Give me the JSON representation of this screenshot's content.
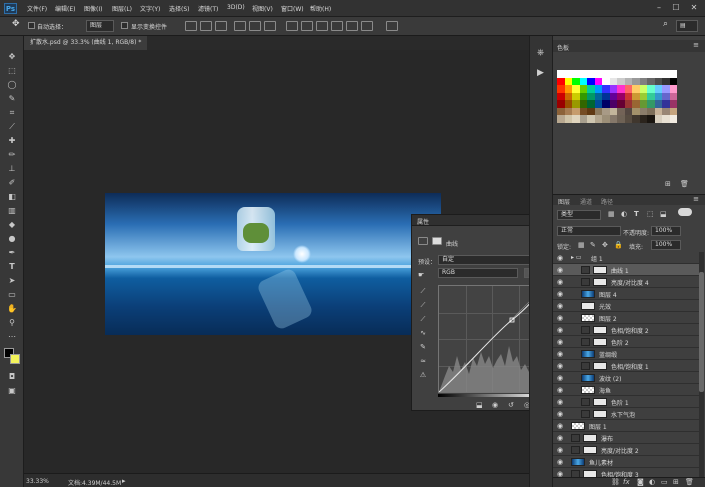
{
  "app": {
    "logo": "Ps"
  },
  "menu": [
    "文件(F)",
    "编辑(E)",
    "图像(I)",
    "图层(L)",
    "文字(Y)",
    "选择(S)",
    "滤镜(T)",
    "3D(D)",
    "视图(V)",
    "窗口(W)",
    "帮助(H)"
  ],
  "options": {
    "auto_select_label": "自动选择：",
    "auto_select_value": "图层",
    "show_transform_label": "显示变换控件"
  },
  "document": {
    "tab_label": "扩散水.psd @ 33.3% (曲线 1, RGB/8) *",
    "status_zoom": "33.33%",
    "status_doc": "文档:4.39M/44.5M"
  },
  "tools": [
    "move-icon",
    "marquee-icon",
    "lasso-icon",
    "quick-select-icon",
    "crop-icon",
    "eyedropper-icon",
    "spot-heal-icon",
    "brush-icon",
    "stamp-icon",
    "history-brush-icon",
    "eraser-icon",
    "gradient-icon",
    "blur-icon",
    "dodge-icon",
    "pen-icon",
    "type-icon",
    "path-select-icon",
    "shape-icon",
    "hand-icon",
    "zoom-icon"
  ],
  "properties": {
    "title": "属性",
    "panel_name": "曲线",
    "preset_label": "预设：",
    "preset_value": "自定",
    "channel_value": "RGB",
    "auto_button": "自动"
  },
  "swatches": {
    "title": "色板",
    "colors": [
      "#ffffff",
      "#ffffff",
      "#ffffff",
      "#ffffff",
      "#ffffff",
      "#ffffff",
      "#ffffff",
      "#ffffff",
      "#ffffff",
      "#ffffff",
      "#ffffff",
      "#ffffff",
      "#ffffff",
      "#ffffff",
      "#ffffff",
      "#ffffff",
      "#ff0000",
      "#ffff00",
      "#00ff00",
      "#00ffff",
      "#0000ff",
      "#ff00ff",
      "#ffffff",
      "#e6e6e6",
      "#cccccc",
      "#b3b3b3",
      "#999999",
      "#808080",
      "#666666",
      "#4d4d4d",
      "#333333",
      "#000000",
      "#ff3300",
      "#ff9900",
      "#ffff33",
      "#66cc00",
      "#00cc99",
      "#0099ff",
      "#3333ff",
      "#9933ff",
      "#ff33cc",
      "#ff6666",
      "#ffcc66",
      "#ccff66",
      "#66ffcc",
      "#66ccff",
      "#9999ff",
      "#ff99cc",
      "#cc0000",
      "#cc6600",
      "#cccc00",
      "#339900",
      "#009966",
      "#006699",
      "#003399",
      "#660099",
      "#990066",
      "#cc3333",
      "#cc9933",
      "#99cc33",
      "#33cc99",
      "#3399cc",
      "#6666cc",
      "#cc6699",
      "#990000",
      "#994c00",
      "#999900",
      "#336600",
      "#006633",
      "#004c99",
      "#000066",
      "#4c0066",
      "#660033",
      "#993333",
      "#996633",
      "#669933",
      "#339966",
      "#336699",
      "#333399",
      "#993366",
      "#8c6239",
      "#a67c52",
      "#c69c6d",
      "#754c24",
      "#603913",
      "#8c7a5e",
      "#a89a86",
      "#c2b59b",
      "#736357",
      "#534741",
      "#a3916b",
      "#8b7d6b",
      "#7d6e5a",
      "#c7b299",
      "#998675",
      "#c5a47e",
      "#b8a890",
      "#d0c4a8",
      "#e0d5be",
      "#a89f8e",
      "#cfc6b0",
      "#b3a68f",
      "#9c8f78",
      "#85786a",
      "#6e6255",
      "#574c41",
      "#40372e",
      "#2b241d",
      "#1a1510",
      "#d8cfbf",
      "#e8e0d2",
      "#f2ece2"
    ]
  },
  "layers": {
    "tabs": [
      "图层",
      "通道",
      "路径"
    ],
    "filter_label": "类型",
    "blend_mode": "正常",
    "opacity_label": "不透明度:",
    "opacity_value": "100%",
    "lock_label": "锁定:",
    "fill_label": "填充:",
    "fill_value": "100%",
    "items": [
      {
        "name": "组 1",
        "kind": "group"
      },
      {
        "name": "曲线 1",
        "kind": "adj"
      },
      {
        "name": "亮度/对比度 4",
        "kind": "adj"
      },
      {
        "name": "图层 4",
        "kind": "image"
      },
      {
        "name": "光效",
        "kind": "plain"
      },
      {
        "name": "图层 2",
        "kind": "checker"
      },
      {
        "name": "色相/饱和度 2",
        "kind": "adj"
      },
      {
        "name": "色阶 2",
        "kind": "adj"
      },
      {
        "name": "蓝绸缎",
        "kind": "image"
      },
      {
        "name": "色相/饱和度 1",
        "kind": "adj"
      },
      {
        "name": "波纹 (2)",
        "kind": "image"
      },
      {
        "name": "海鱼",
        "kind": "checker"
      },
      {
        "name": "色阶 1",
        "kind": "adj"
      },
      {
        "name": "水下气泡",
        "kind": "adj"
      },
      {
        "name": "图层 1",
        "kind": "checker"
      },
      {
        "name": "瀑布",
        "kind": "adj"
      },
      {
        "name": "亮度/对比度 2",
        "kind": "adj"
      },
      {
        "name": "鱼儿素材",
        "kind": "image"
      },
      {
        "name": "色相/饱和度 3",
        "kind": "adj"
      }
    ]
  }
}
